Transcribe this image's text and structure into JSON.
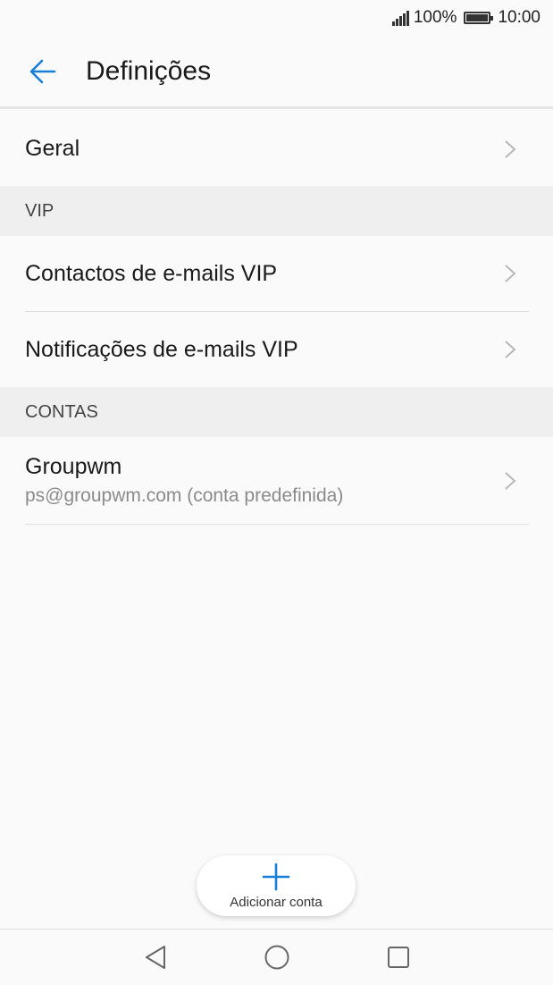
{
  "status_bar": {
    "battery_percent": "100%",
    "time": "10:00",
    "signal_icon": "signal-icon",
    "battery_icon": "battery-icon"
  },
  "app_bar": {
    "title": "Definições",
    "back_icon": "back-arrow-icon"
  },
  "general": {
    "label": "Geral"
  },
  "vip_section": {
    "header": "VIP",
    "items": [
      {
        "label": "Contactos de e-mails VIP"
      },
      {
        "label": "Notificações de e-mails VIP"
      }
    ]
  },
  "accounts_section": {
    "header": "CONTAS",
    "account": {
      "name": "Groupwm",
      "detail": "ps@groupwm.com (conta predefinida)"
    }
  },
  "fab": {
    "label": "Adicionar conta",
    "icon": "plus-icon"
  },
  "nav_bar": {
    "back": "nav-back-icon",
    "home": "nav-home-icon",
    "recents": "nav-recents-icon"
  },
  "colors": {
    "accent": "#1a7fd8",
    "background": "#fafafa",
    "section_header_bg": "#efefef"
  }
}
